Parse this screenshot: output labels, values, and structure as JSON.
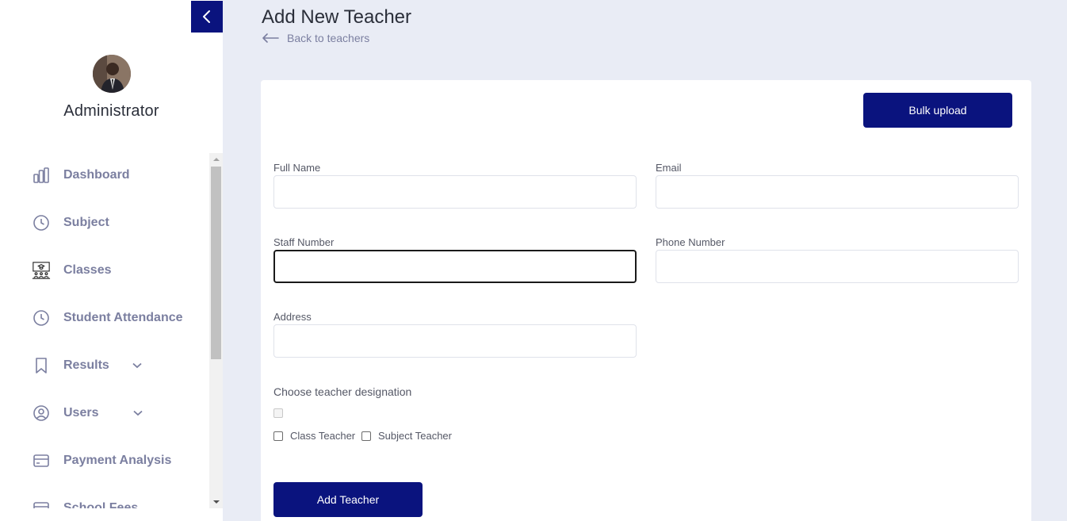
{
  "sidebar": {
    "user_name": "Administrator",
    "nav": [
      {
        "label": "Dashboard",
        "icon": "bar-chart-icon"
      },
      {
        "label": "Subject",
        "icon": "clock-icon"
      },
      {
        "label": "Classes",
        "icon": "classroom-icon"
      },
      {
        "label": "Student Attendance",
        "icon": "clock-icon"
      },
      {
        "label": "Results",
        "icon": "bookmark-icon",
        "expandable": true
      },
      {
        "label": "Users",
        "icon": "user-circle-icon",
        "expandable": true
      },
      {
        "label": "Payment Analysis",
        "icon": "credit-card-icon"
      },
      {
        "label": "School Fees",
        "icon": "credit-card-icon"
      }
    ]
  },
  "header": {
    "title": "Add New Teacher",
    "back_label": "Back to teachers"
  },
  "form": {
    "bulk_upload_label": "Bulk upload",
    "full_name": {
      "label": "Full Name",
      "value": ""
    },
    "email": {
      "label": "Email",
      "value": ""
    },
    "staff_number": {
      "label": "Staff Number",
      "value": ""
    },
    "phone_number": {
      "label": "Phone Number",
      "value": ""
    },
    "address": {
      "label": "Address",
      "value": ""
    },
    "designation": {
      "label": "Choose teacher designation",
      "options": [
        "Class Teacher",
        "Subject Teacher"
      ]
    },
    "submit_label": "Add Teacher"
  },
  "colors": {
    "primary": "#0a137e",
    "nav_text": "#7b7fa0",
    "background": "#e9ecf5"
  }
}
